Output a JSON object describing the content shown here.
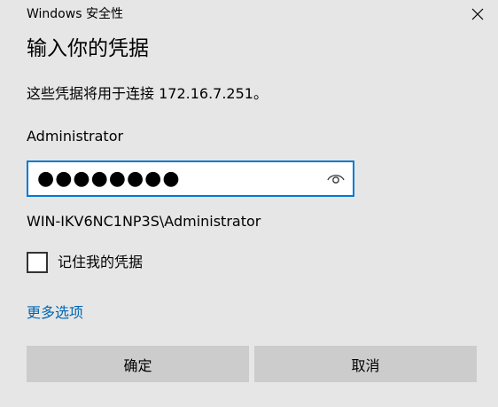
{
  "window": {
    "title": "Windows 安全性"
  },
  "dialog": {
    "heading": "输入你的凭据",
    "connect_text": "这些凭据将用于连接 172.16.7.251。",
    "username": "Administrator",
    "password_masked": "●●●●●●●●",
    "domain_user": "WIN-IKV6NC1NP3S\\Administrator",
    "remember_label": "记住我的凭据",
    "remember_checked": false,
    "more_options": "更多选项"
  },
  "buttons": {
    "ok_label": "确定",
    "cancel_label": "取消"
  },
  "icons": {
    "close": "close-icon",
    "reveal": "eye-icon"
  },
  "colors": {
    "background": "#e6e6e6",
    "focus_border": "#0078d7",
    "link": "#0066b4",
    "button": "#cccccc"
  }
}
